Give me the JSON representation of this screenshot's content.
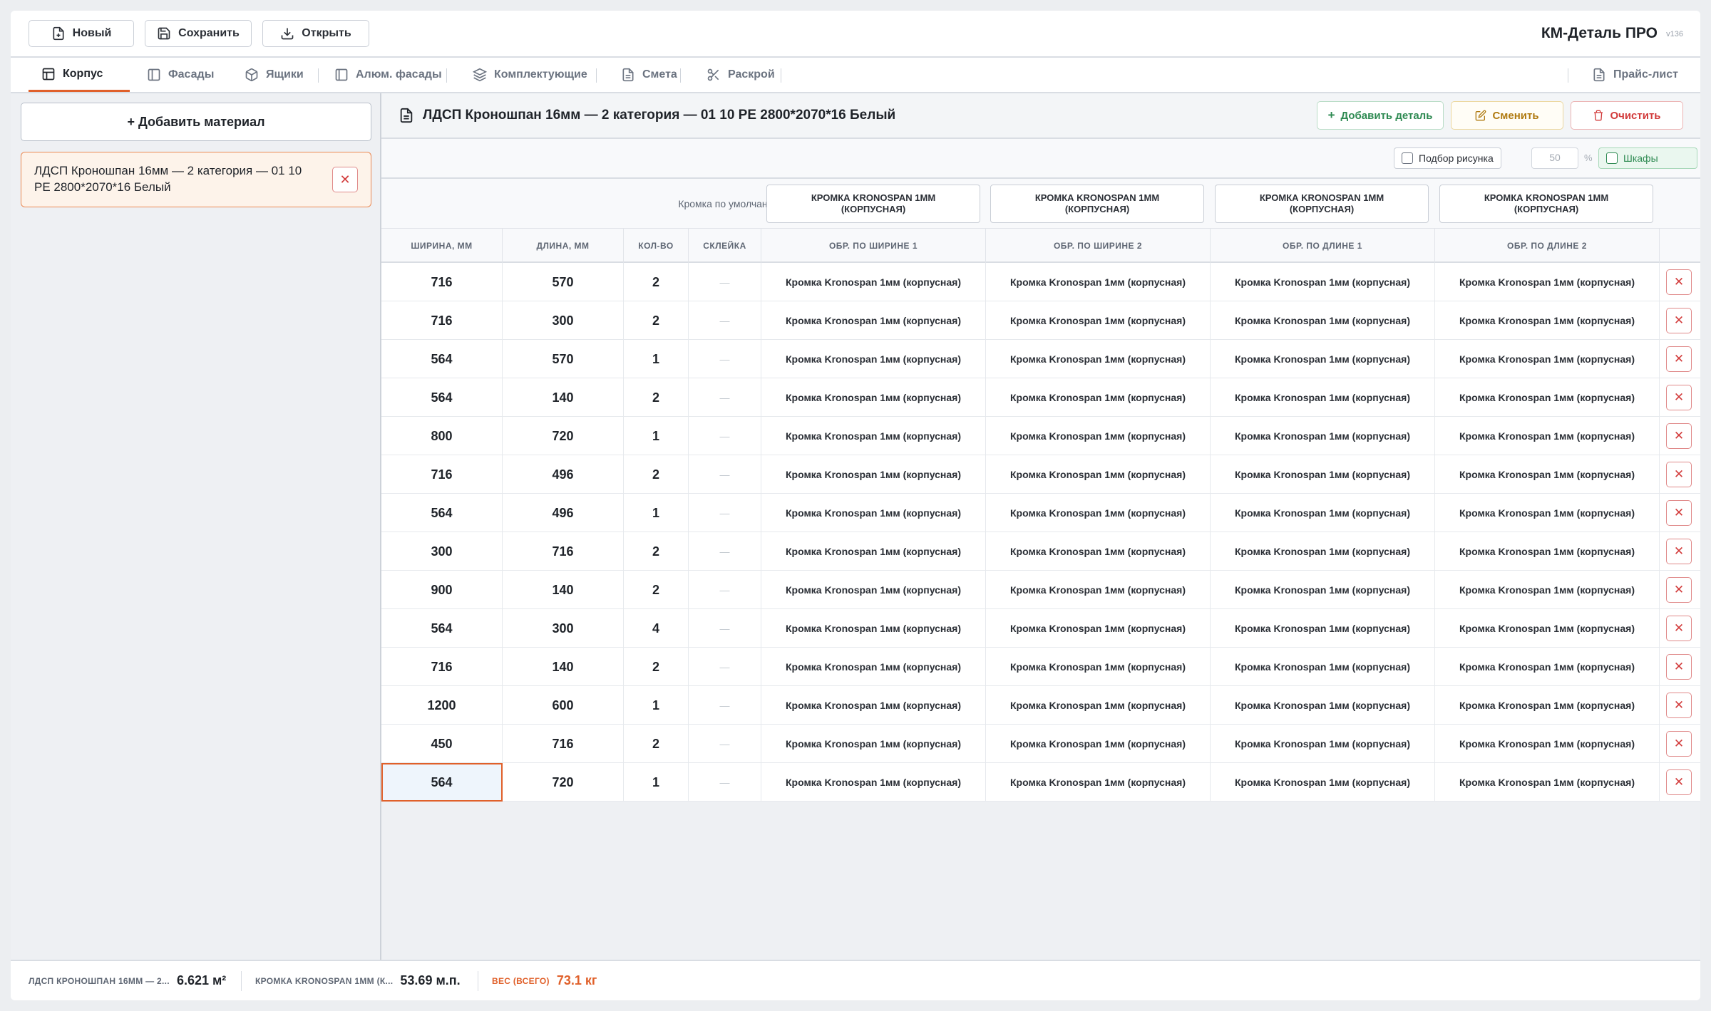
{
  "toolbar": {
    "new_label": "Новый",
    "save_label": "Сохранить",
    "open_label": "Открыть",
    "brand": "КМ-Деталь ПРО",
    "version": "v136"
  },
  "tabs": [
    {
      "label": "Корпус",
      "icon": "layout-icon",
      "active": true
    },
    {
      "label": "Фасады",
      "icon": "panel-icon",
      "active": false
    },
    {
      "label": "Ящики",
      "icon": "box-icon",
      "active": false
    },
    {
      "label": "Алюм. фасады",
      "icon": "frame-icon",
      "active": false
    },
    {
      "label": "Комплектующие",
      "icon": "layers-icon",
      "active": false
    },
    {
      "label": "Смета",
      "icon": "document-icon",
      "active": false
    },
    {
      "label": "Раскрой",
      "icon": "scissors-icon",
      "active": false
    }
  ],
  "price_list_label": "Прайс-лист",
  "sidebar": {
    "add_material_label": "+ Добавить материал",
    "materials": [
      {
        "name": "ЛДСП Кроношпан 16мм — 2 категория — 01 10 PE 2800*2070*16 Белый",
        "selected": true
      }
    ]
  },
  "main": {
    "title": "ЛДСП Кроношпан 16мм — 2 категория — 01 10 PE 2800*2070*16 Белый",
    "add_detail_label": "Добавить деталь",
    "replace_label": "Сменить",
    "clear_label": "Очистить",
    "pattern_label": "Подбор рисунка",
    "pattern_percent": "50",
    "percent_sign": "%",
    "cabinets_label": "Шкафы",
    "edge_default_label": "Кромка по умолчанию",
    "edge_defaults": [
      "Кромка Kronospan 1мм (корпусная)",
      "Кромка Kronospan 1мм (корпусная)",
      "Кромка Kronospan 1мм (корпусная)",
      "Кромка Kronospan 1мм (корпусная)"
    ],
    "columns": [
      "Ширина, мм",
      "Длина, мм",
      "Кол-во",
      "Склейка",
      "Обр. по ширине 1",
      "Обр. по ширине 2",
      "Обр. по длине 1",
      "Обр. по длине 2"
    ],
    "edge_value": "Кромка Kronospan 1мм (корпусная)",
    "dash": "—",
    "rows": [
      {
        "w": "716",
        "l": "570",
        "q": "2"
      },
      {
        "w": "716",
        "l": "300",
        "q": "2"
      },
      {
        "w": "564",
        "l": "570",
        "q": "1"
      },
      {
        "w": "564",
        "l": "140",
        "q": "2"
      },
      {
        "w": "800",
        "l": "720",
        "q": "1"
      },
      {
        "w": "716",
        "l": "496",
        "q": "2"
      },
      {
        "w": "564",
        "l": "496",
        "q": "1"
      },
      {
        "w": "300",
        "l": "716",
        "q": "2"
      },
      {
        "w": "900",
        "l": "140",
        "q": "2"
      },
      {
        "w": "564",
        "l": "300",
        "q": "4"
      },
      {
        "w": "716",
        "l": "140",
        "q": "2"
      },
      {
        "w": "1200",
        "l": "600",
        "q": "1"
      },
      {
        "w": "450",
        "l": "716",
        "q": "2"
      },
      {
        "w": "564",
        "l": "720",
        "q": "1"
      }
    ]
  },
  "footer": {
    "material_label": "ЛДСП Кроношпан 16мм — 2...",
    "material_value": "6.621 м²",
    "edge_label": "Кромка Kronospan 1мм (К...",
    "edge_value": "53.69 м.п.",
    "weight_label": "Вес (всего)",
    "weight_value": "73.1 кг"
  },
  "colors": {
    "accent": "#e0602a",
    "danger": "#d23b3b",
    "success": "#2e9e5b",
    "warning": "#c98a12"
  }
}
